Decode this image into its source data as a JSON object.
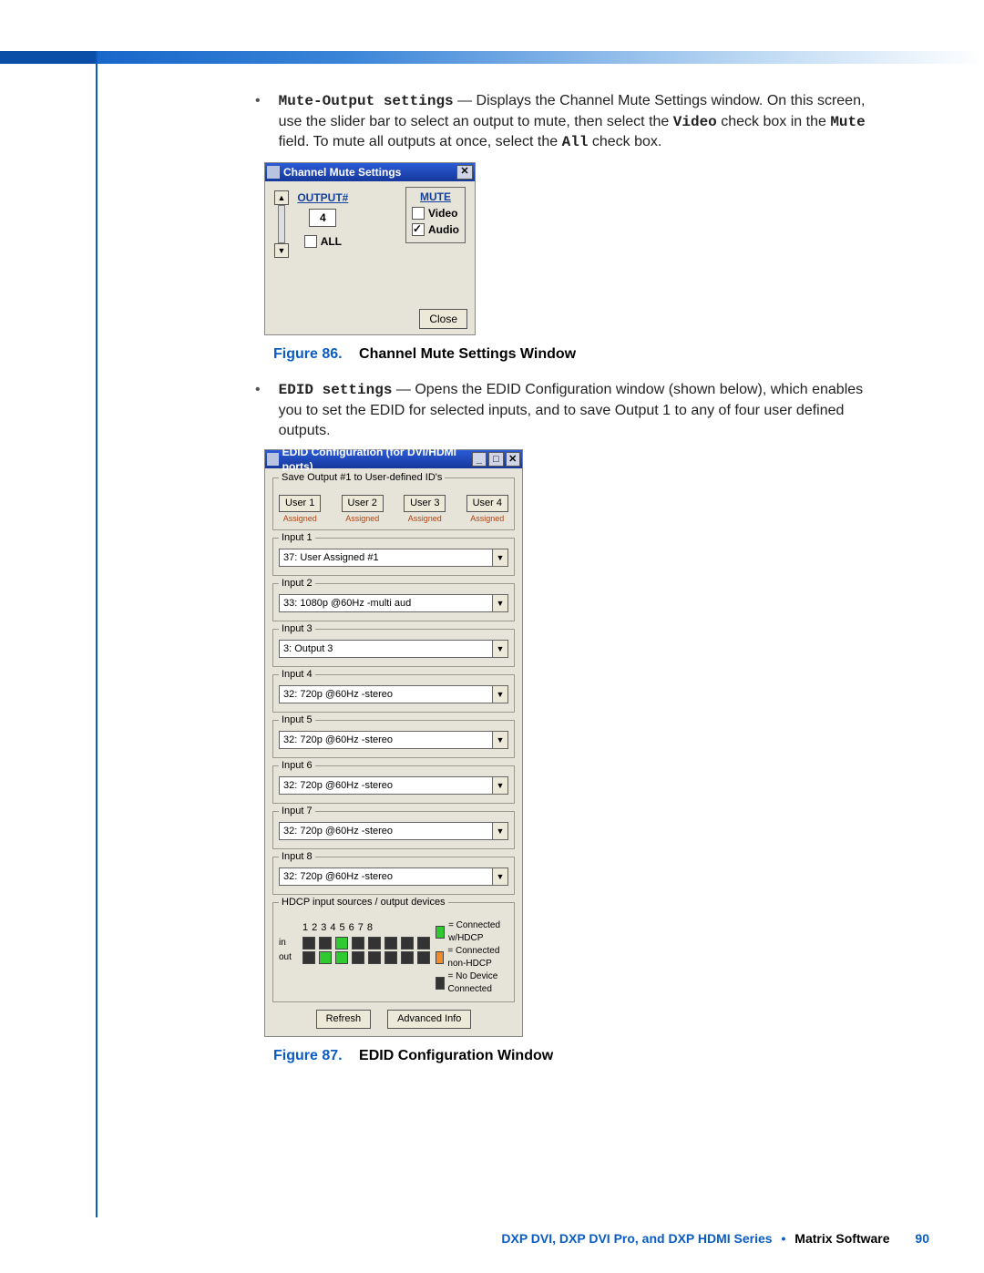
{
  "bullets": [
    {
      "title": "Mute-Output settings",
      "text1": " — Displays the Channel Mute Settings window. On this screen, use the slider bar to select an output to mute, then select the ",
      "video_word": "Video",
      "text2": " check box in the ",
      "mute_word": "Mute",
      "text3": " field. To mute all outputs at once, select the ",
      "all_word": "All",
      "text4": " check box."
    },
    {
      "title": "EDID settings",
      "text": " — Opens the EDID Configuration window (shown below), which enables you to set the EDID for selected inputs, and to save Output 1 to any of four user defined outputs."
    }
  ],
  "mute_window": {
    "title": "Channel Mute Settings",
    "output_label": "OUTPUT#",
    "output_value": "4",
    "all_label": "ALL",
    "mute_label": "MUTE",
    "video_label": "Video",
    "audio_label": "Audio",
    "close_btn": "Close"
  },
  "captions": {
    "fig86": {
      "num": "Figure 86.",
      "text": "Channel Mute Settings Window"
    },
    "fig87": {
      "num": "Figure 87.",
      "text": "EDID Configuration Window"
    }
  },
  "edid_window": {
    "title": "EDID Configuration (for DVI/HDMI ports)",
    "save_legend": "Save Output #1 to User-defined ID's",
    "users": [
      "User 1",
      "User 2",
      "User 3",
      "User 4"
    ],
    "assigned": "Assigned",
    "inputs": [
      {
        "label": "Input 1",
        "value": "37: User Assigned #1"
      },
      {
        "label": "Input 2",
        "value": "33: 1080p @60Hz -multi aud"
      },
      {
        "label": "Input 3",
        "value": "3: Output 3"
      },
      {
        "label": "Input 4",
        "value": "32: 720p @60Hz -stereo"
      },
      {
        "label": "Input 5",
        "value": "32: 720p @60Hz -stereo"
      },
      {
        "label": "Input 6",
        "value": "32: 720p @60Hz -stereo"
      },
      {
        "label": "Input 7",
        "value": "32: 720p @60Hz -stereo"
      },
      {
        "label": "Input 8",
        "value": "32: 720p @60Hz -stereo"
      }
    ],
    "hdcp_legend": "HDCP input sources / output devices",
    "in_label": "in",
    "out_label": "out",
    "legend": [
      "= Connected w/HDCP",
      "= Connected non-HDCP",
      "= No Device Connected"
    ],
    "refresh_btn": "Refresh",
    "advanced_btn": "Advanced Info"
  },
  "footer": {
    "product": "DXP DVI, DXP DVI Pro, and DXP HDMI Series",
    "section": "Matrix Software",
    "page": "90"
  }
}
